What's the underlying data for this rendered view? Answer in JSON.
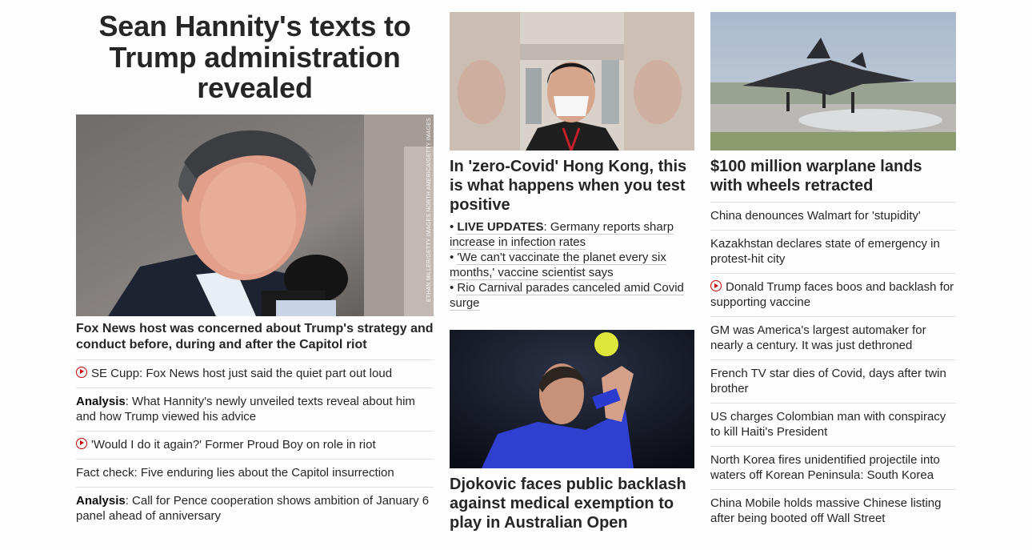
{
  "lead": {
    "title": "Sean Hannity's texts to Trump administration revealed",
    "image_credit": "ETHAN MILLER/GETTY IMAGES NORTH AMERICA/GETTY IMAGES",
    "headline": "Fox News host was concerned about Trump's strategy and conduct before, during and after the Capitol riot",
    "related": [
      {
        "type": "video",
        "prefix": "",
        "text": "SE Cupp: Fox News host just said the quiet part out loud"
      },
      {
        "type": "text",
        "prefix": "Analysis",
        "text": ": What Hannity's newly unveiled texts reveal about him and how Trump viewed his advice"
      },
      {
        "type": "video",
        "prefix": "",
        "text": "'Would I do it again?' Former Proud Boy on role in riot"
      },
      {
        "type": "text",
        "prefix": "",
        "text": "Fact check: Five enduring lies about the Capitol insurrection"
      },
      {
        "type": "text",
        "prefix": "Analysis",
        "text": ": Call for Pence cooperation shows ambition of January 6 panel ahead of anniversary"
      }
    ]
  },
  "middle": {
    "story1": {
      "headline": "In 'zero-Covid' Hong Kong, this is what happens when you test positive",
      "bullets": [
        {
          "prefix": "LIVE UPDATES",
          "text": ": Germany reports sharp increase in infection rates"
        },
        {
          "prefix": "",
          "text": "'We can't vaccinate the planet every six months,' vaccine scientist says"
        },
        {
          "prefix": "",
          "text": "Rio Carnival parades canceled amid Covid surge"
        }
      ]
    },
    "story2": {
      "headline": "Djokovic faces public backlash against medical exemption to play in Australian Open"
    }
  },
  "right": {
    "headline": "$100 million warplane lands with wheels retracted",
    "items": [
      {
        "type": "text",
        "text": "China denounces Walmart for 'stupidity'"
      },
      {
        "type": "text",
        "text": "Kazakhstan declares state of emergency in protest-hit city"
      },
      {
        "type": "video",
        "text": "Donald Trump faces boos and backlash for supporting vaccine"
      },
      {
        "type": "text",
        "text": "GM was America's largest automaker for nearly a century. It was just dethroned"
      },
      {
        "type": "text",
        "text": "French TV star dies of Covid, days after twin brother"
      },
      {
        "type": "text",
        "text": "US charges Colombian man with conspiracy to kill Haiti's President"
      },
      {
        "type": "text",
        "text": "North Korea fires unidentified projectile into waters off Korean Peninsula: South Korea"
      },
      {
        "type": "text",
        "text": "China Mobile holds massive Chinese listing after being booted off Wall Street"
      }
    ]
  },
  "colors": {
    "accent_red": "#cc0000",
    "divider": "#e1e1e1",
    "text": "#262626"
  },
  "icons": {
    "video": "play-circle-icon"
  }
}
